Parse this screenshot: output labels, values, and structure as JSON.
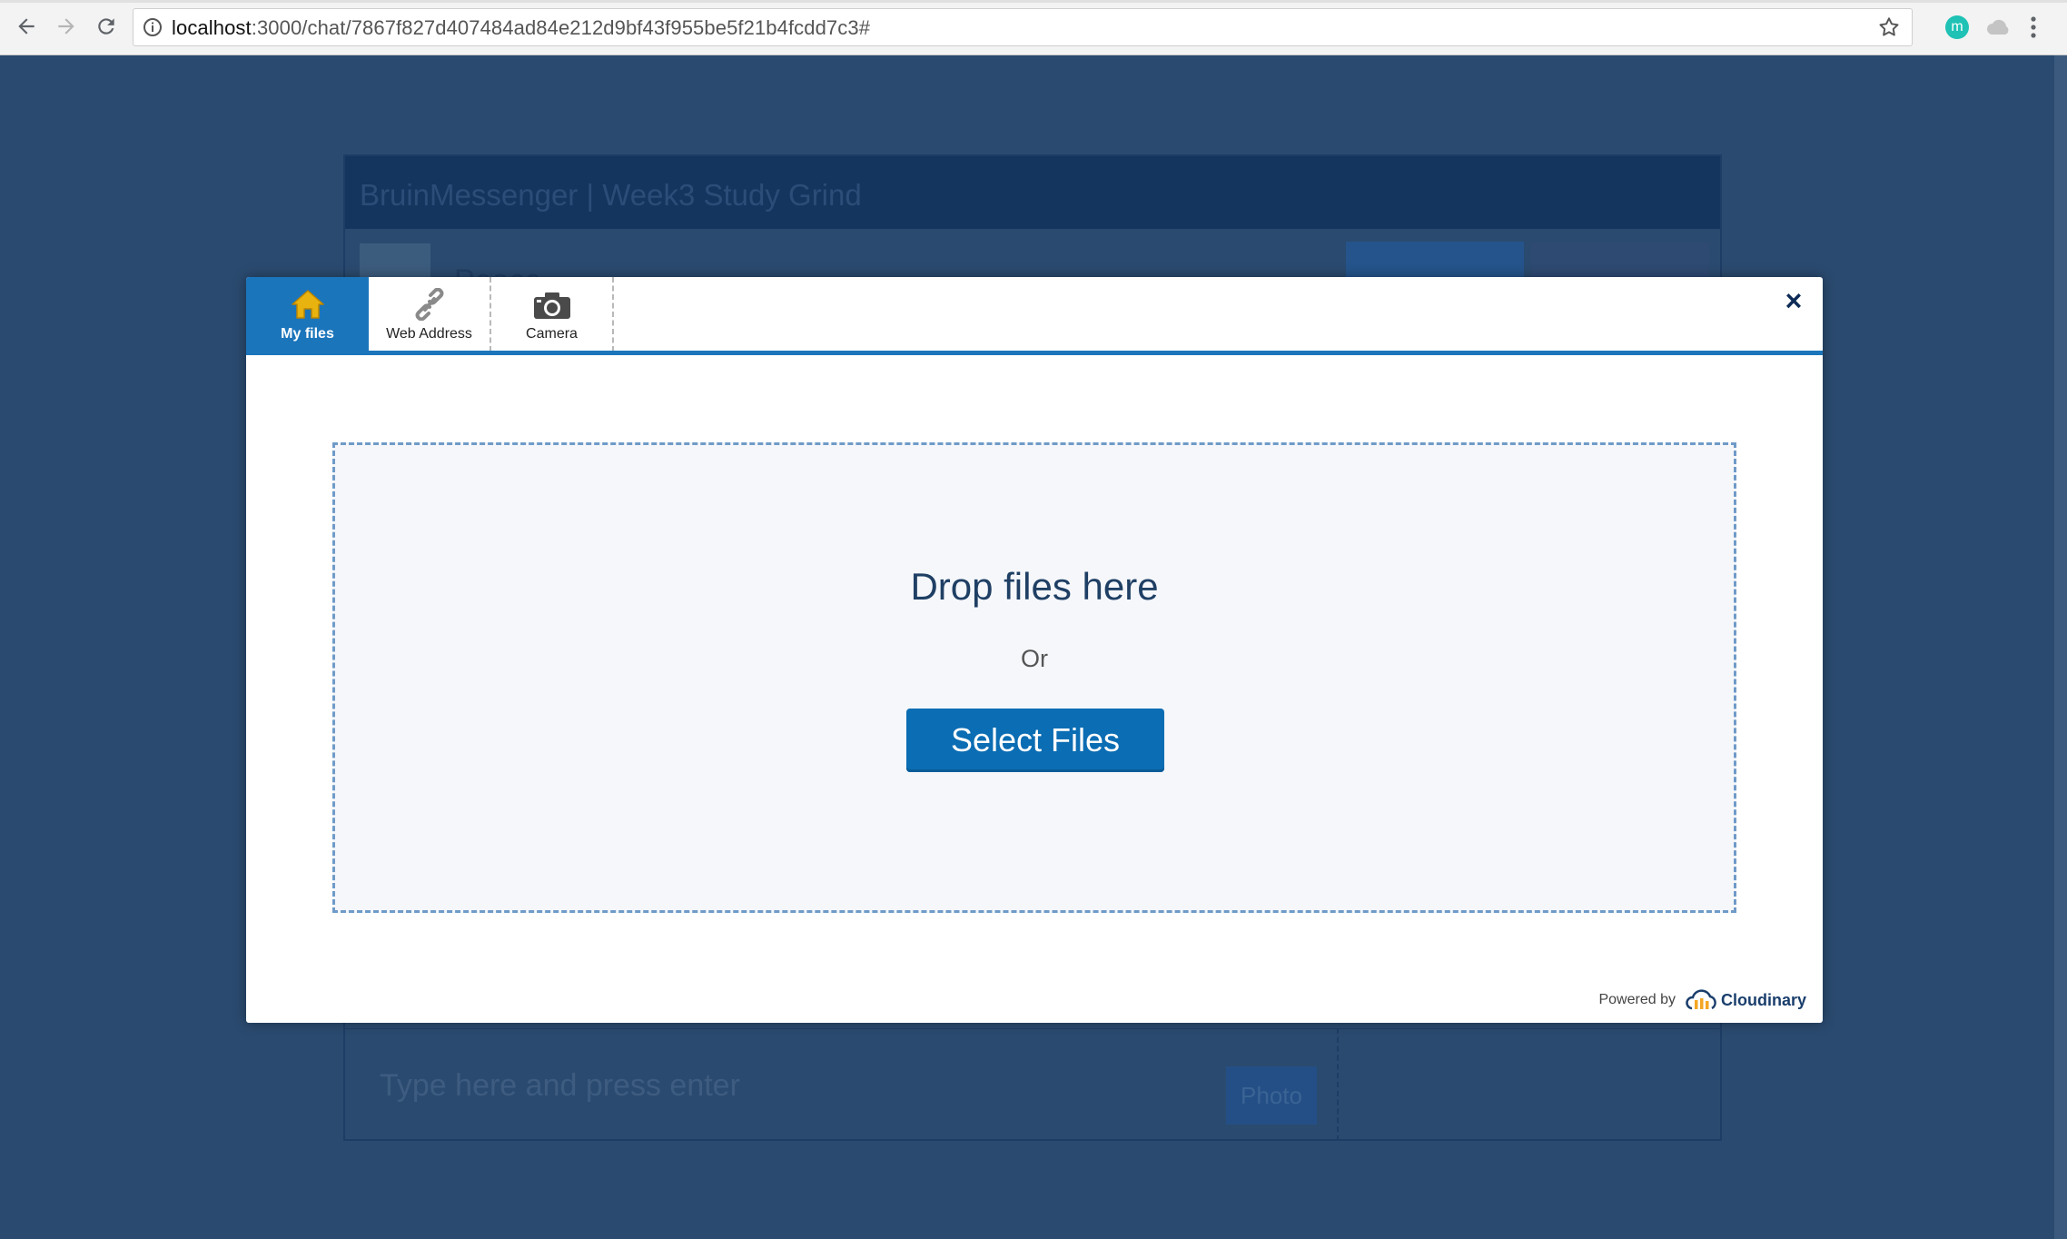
{
  "browser": {
    "url_host": "localhost",
    "url_path": ":3000/chat/7867f827d407484ad84e212d9bf43f955be5f21b4fcdd7c3#",
    "extension_badge": "m"
  },
  "background_app": {
    "title": "BruinMessenger | Week3 Study Grind",
    "room_name": "Peace",
    "message_placeholder": "Type here and press enter",
    "photo_button": "Photo"
  },
  "upload_widget": {
    "tabs": [
      {
        "label": "My files",
        "icon": "home-icon",
        "active": true
      },
      {
        "label": "Web Address",
        "icon": "link-icon",
        "active": false
      },
      {
        "label": "Camera",
        "icon": "camera-icon",
        "active": false
      }
    ],
    "close": "×",
    "drop_title": "Drop files here",
    "or_text": "Or",
    "select_button": "Select Files",
    "powered_by": "Powered by",
    "brand": "Cloudinary"
  },
  "colors": {
    "overlay": "#2a4a6f",
    "accent": "#1b75bb",
    "button": "#0b6db3",
    "home_icon": "#e8b20f",
    "cloudinary_orange": "#f5a623"
  }
}
